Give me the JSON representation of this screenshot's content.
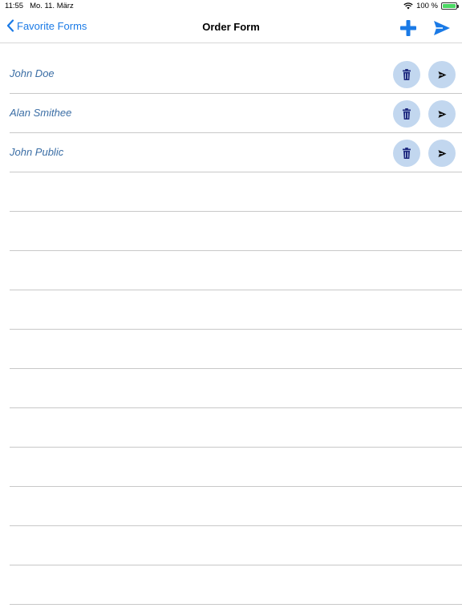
{
  "status_bar": {
    "time": "11:55",
    "date": "Mo. 11. März",
    "battery_percent": "100 %"
  },
  "nav": {
    "back_label": "Favorite Forms",
    "title": "Order Form"
  },
  "colors": {
    "accent": "#1a7ae6",
    "name_text": "#3b6ea5",
    "button_bg": "#c2d7ef",
    "trash_icon": "#1f2a80"
  },
  "entries": [
    {
      "name": "John Doe"
    },
    {
      "name": "Alan Smithee"
    },
    {
      "name": "John Public"
    }
  ]
}
